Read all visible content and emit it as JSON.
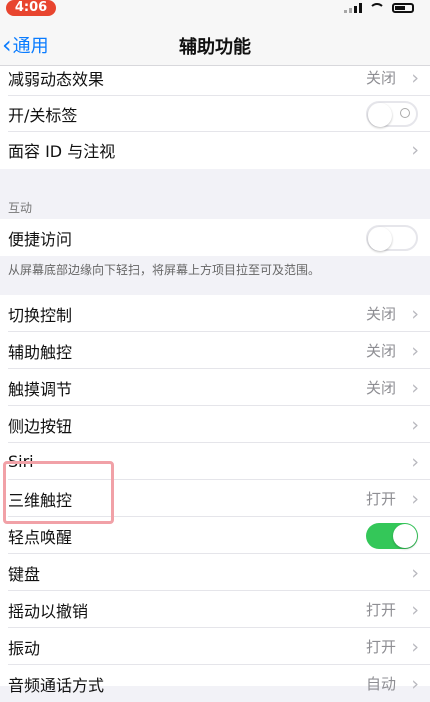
{
  "status_bar": {
    "time": "4:06"
  },
  "nav": {
    "back_label": "通用",
    "title": "辅助功能"
  },
  "rows_group1": [
    {
      "label": "减弱动态效果",
      "value": "关闭"
    },
    {
      "label": "开/关标签"
    },
    {
      "label": "面容 ID 与注视"
    }
  ],
  "section": {
    "header": "互动"
  },
  "rows_group2": [
    {
      "label": "便捷访问"
    }
  ],
  "footer_note": "从屏幕底部边缘向下轻扫，将屏幕上方项目拉至可及范围。",
  "rows_group3": [
    {
      "label": "切换控制",
      "value": "关闭"
    },
    {
      "label": "辅助触控",
      "value": "关闭"
    },
    {
      "label": "触摸调节",
      "value": "关闭"
    },
    {
      "label": "侧边按钮"
    },
    {
      "label": "Siri"
    },
    {
      "label": "三维触控",
      "value": "打开"
    },
    {
      "label": "轻点唤醒"
    },
    {
      "label": "键盘"
    },
    {
      "label": "摇动以撤销",
      "value": "打开"
    },
    {
      "label": "振动",
      "value": "打开"
    },
    {
      "label": "音频通话方式",
      "value": "自动"
    }
  ],
  "toggles": {
    "onoff_labels": "off",
    "reachability": "off",
    "tap_to_wake": "on"
  },
  "colors": {
    "accent": "#0a7cff",
    "toggle_on": "#34c759",
    "highlight": "#f1a1a7",
    "time_pill": "#e8452f"
  }
}
